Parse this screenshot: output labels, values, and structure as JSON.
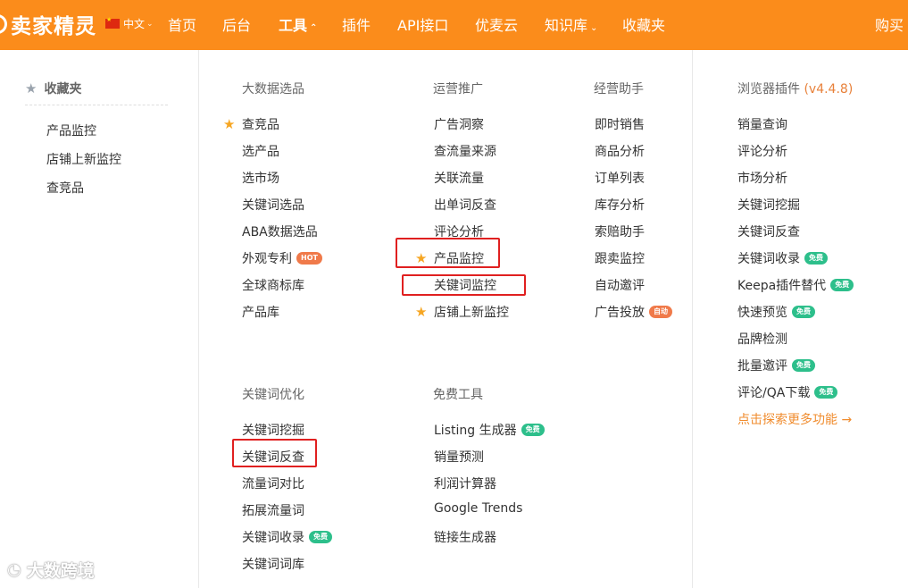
{
  "topbar": {
    "logo_text": "卖家精灵",
    "language": "中文",
    "nav": [
      "首页",
      "后台",
      "工具",
      "插件",
      "API接口",
      "优麦云",
      "知识库",
      "收藏夹"
    ],
    "right_action": "购买"
  },
  "favorites": {
    "title": "收藏夹",
    "items": [
      "产品监控",
      "店铺上新监控",
      "查竞品"
    ]
  },
  "columns": {
    "big_data": {
      "title": "大数据选品",
      "items": [
        "查竞品",
        "选产品",
        "选市场",
        "关键词选品",
        "ABA数据选品",
        "外观专利",
        "全球商标库",
        "产品库"
      ],
      "hot_badge": "HOT"
    },
    "operations": {
      "title": "运营推广",
      "items": [
        "广告洞察",
        "查流量来源",
        "关联流量",
        "出单词反查",
        "评论分析",
        "产品监控",
        "关键词监控",
        "店铺上新监控"
      ]
    },
    "assistant": {
      "title": "经营助手",
      "items": [
        "即时销售",
        "商品分析",
        "订单列表",
        "库存分析",
        "索赔助手",
        "跟卖监控",
        "自动邀评",
        "广告投放"
      ],
      "auto_badge": "自动"
    },
    "keyword_opt": {
      "title": "关键词优化",
      "items": [
        "关键词挖掘",
        "关键词反查",
        "流量词对比",
        "拓展流量词",
        "关键词收录",
        "关键词词库"
      ]
    },
    "free_tools": {
      "title": "免费工具",
      "items": [
        "Listing 生成器",
        "销量预测",
        "利润计算器",
        "Google Trends",
        "链接生成器"
      ]
    },
    "plugin": {
      "title": "浏览器插件",
      "version": "(v4.4.8)",
      "items": [
        "销量查询",
        "评论分析",
        "市场分析",
        "关键词挖掘",
        "关键词反查",
        "关键词收录",
        "Keepa插件替代",
        "快速预览",
        "品牌检测",
        "批量邀评",
        "评论/QA下载"
      ],
      "more_link": "点击探索更多功能 →"
    }
  },
  "free_badge": "免费",
  "watermark": "大数跨境",
  "colors": {
    "topbar": "#fb8c1b",
    "highlight_box": "#e02020",
    "star": "#f6a623",
    "free_badge": "#2dbf8b",
    "hot_badge": "#f07a4a"
  },
  "icons": {
    "favorite_head": "star-icon",
    "favorited_item": "star-icon",
    "dropdown": "chevron-down-icon",
    "expanded": "chevron-up-icon"
  }
}
